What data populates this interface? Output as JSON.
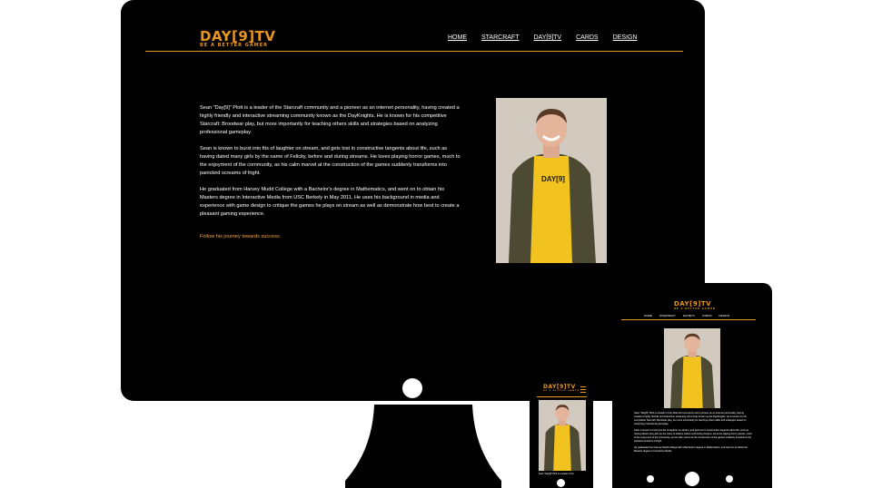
{
  "brand": {
    "name": "DAY[9]TV",
    "tagline": "BE A BETTER GAMER"
  },
  "nav": {
    "items": [
      {
        "label": "HOME"
      },
      {
        "label": "STARCRAFT"
      },
      {
        "label": "DAY[9]TV"
      },
      {
        "label": "CARDS"
      },
      {
        "label": "DESIGN"
      }
    ]
  },
  "content": {
    "paragraphs": [
      "Sean \"Day[9]\" Plott is a leader of the Starcraft community and a pioneer as an internet personality, having created a highly friendly and interactive streaming community known as the DayKnights. He is known for his competitive Starcraft: Broodwar play, but more importantly for teaching others skills and strategies based on analyzing professional gameplay.",
      "Sean is known to burst into fits of laughter on stream, and gets lost in constructive tangents about life, such as having dated many girls by the name of Felicity, before and during streams. He loves playing horror games, much to the enjoyment of the community, as his calm marvel at the construction of the games suddenly transforms into panicked screams of fright.",
      "He graduated from Harvey Mudd College with a Bachelor's degree in Mathematics, and went on to obtain his Masters degree in Interactive Media from USC Berkely in May 2011. He uses his background in media and experience with game design to critique the games he plays on stream as well as demonstrate how best to create a pleasant gaming experience."
    ],
    "cta": "Follow his journey towards success.",
    "shirt_text": "DAY[9]TV"
  },
  "tablet": {
    "paragraphs": [
      "Sean \"Day[9]\" Plott is a leader of the Starcraft community and a pioneer as an internet personality, having created a highly friendly and interactive streaming community known as the DayKnights. He is known for his competitive Starcraft: Broodwar play, but more importantly for teaching others skills and strategies based on analyzing professional gameplay.",
      "Sean is known to burst into fits of laughter on stream, and gets lost in constructive tangents about life, such as having dated many girls by the name of Felicity, before and during streams. He loves playing horror games, much to the enjoyment of the community, as his calm marvel at the construction of the games suddenly transforms into panicked screams of fright.",
      "He graduated from Harvey Mudd College with a Bachelor's degree in Mathematics, and went on to obtain his Masters degree in Interactive Media."
    ]
  },
  "phone": {
    "snippet": "Sean \"Day[9]\" Plott is a leader of the"
  },
  "colors": {
    "accent": "#e8961f",
    "background": "#000000",
    "text": "#ffffff"
  },
  "icons": {
    "menu": "hamburger-icon"
  }
}
